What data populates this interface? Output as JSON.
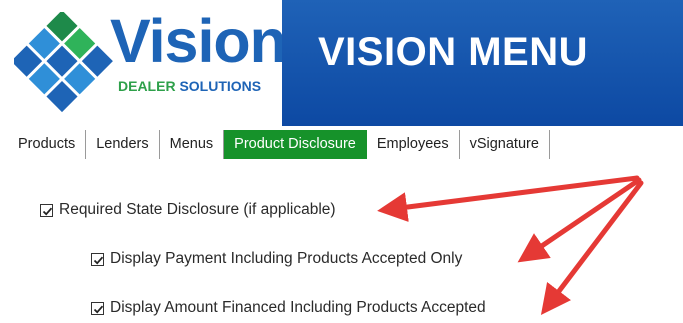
{
  "logo": {
    "word": "Vision",
    "sub_1": "DEALER",
    "sub_2": "SOLUTIONS"
  },
  "banner": {
    "title": "VISION MENU"
  },
  "tabs": [
    {
      "label": "Products"
    },
    {
      "label": "Lenders"
    },
    {
      "label": "Menus"
    },
    {
      "label": "Product Disclosure",
      "active": true
    },
    {
      "label": "Employees"
    },
    {
      "label": "vSignature"
    }
  ],
  "options": {
    "required_state": {
      "label": "Required State Disclosure (if applicable)",
      "checked": true
    },
    "display_payment": {
      "label": "Display Payment Including Products Accepted Only",
      "checked": true
    },
    "display_amount": {
      "label": "Display Amount Financed Including Products Accepted",
      "checked": true
    }
  },
  "colors": {
    "brand_blue": "#1e64b6",
    "brand_green": "#2ea04a",
    "active_tab": "#16922a",
    "arrow_red": "#e53935"
  },
  "icons": [
    "vision-logo-icon",
    "checkbox-checked-icon",
    "red-arrow-icon"
  ]
}
